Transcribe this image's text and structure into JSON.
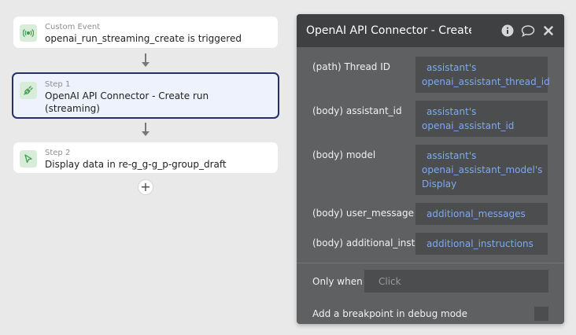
{
  "workflow": {
    "event": {
      "kicker": "Custom Event",
      "title": "openai_run_streaming_create is triggered",
      "icon": "broadcast-icon"
    },
    "step1": {
      "kicker": "Step 1",
      "title_line1": "OpenAI API Connector - Create run",
      "title_line2": "(streaming)",
      "icon": "plug-icon"
    },
    "step2": {
      "kicker": "Step 2",
      "title": "Display data in re-g_g-g_p-group_draft",
      "icon": "cursor-icon"
    },
    "add_label": "+"
  },
  "panel": {
    "title": "OpenAI API Connector - Create r",
    "fields": [
      {
        "label": "(path) Thread ID",
        "value_lines": [
          "assistant's",
          "openai_assistant_thread_id"
        ]
      },
      {
        "label": "(body) assistant_id",
        "value_lines": [
          "assistant's",
          "openai_assistant_id"
        ]
      },
      {
        "label": "(body) model",
        "value_lines": [
          "assistant's",
          "openai_assistant_model's",
          "Display"
        ]
      },
      {
        "label": "(body) user_message",
        "value_lines": [
          "additional_messages"
        ]
      },
      {
        "label": "(body) additional_instr",
        "value_lines": [
          "additional_instructions"
        ]
      }
    ],
    "only_when_label": "Only when",
    "only_when_placeholder": "Click",
    "breakpoint_label": "Add a breakpoint in debug mode"
  },
  "colors": {
    "selected_border": "#26316a",
    "value_text": "#7fa8f2",
    "icon_bg": "#d7ecd9",
    "icon_fg": "#3f9a4f"
  }
}
